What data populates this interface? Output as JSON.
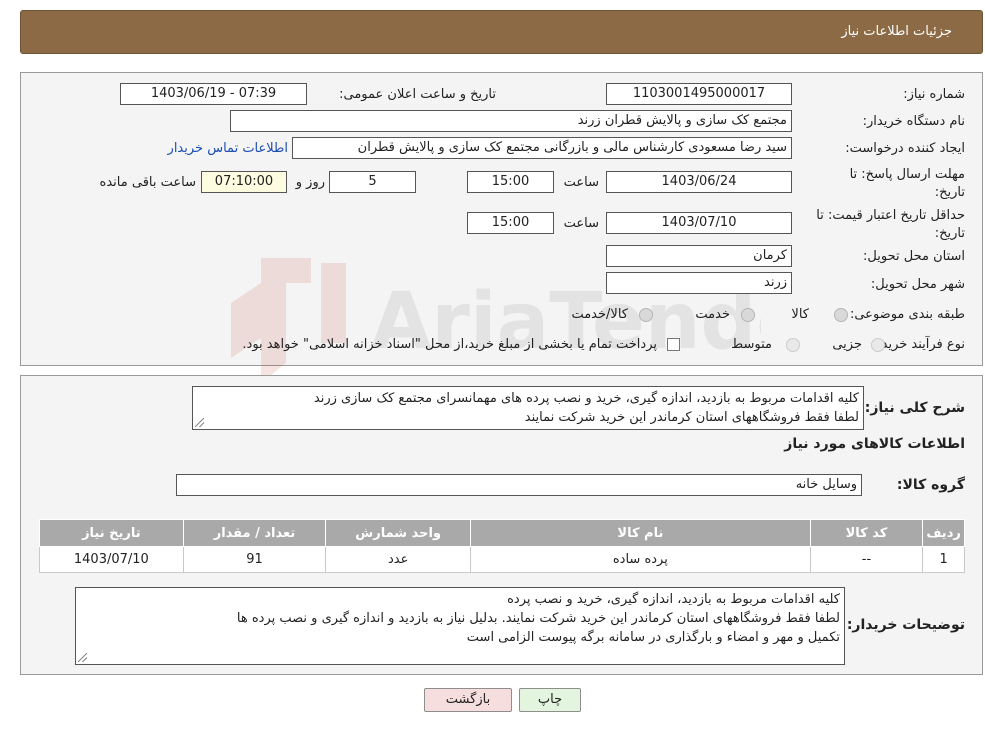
{
  "header": {
    "title": "جزئیات اطلاعات نیاز"
  },
  "form": {
    "need_number_label": "شماره نیاز:",
    "need_number": "1103001495000017",
    "announce_label": "تاریخ و ساعت اعلان عمومی:",
    "announce_value": "1403/06/19 - 07:39",
    "buyer_org_label": "نام دستگاه خریدار:",
    "buyer_org": "مجتمع کک سازی و پالایش قطران زرند",
    "creator_label": "ایجاد کننده درخواست:",
    "creator": "سید رضا مسعودی کارشناس مالی و بازرگانی مجتمع کک سازی و پالایش قطران",
    "contact_link": "اطلاعات تماس خریدار",
    "deadline_label_1": "مهلت ارسال پاسخ: تا",
    "deadline_label_2": "تاریخ:",
    "deadline_date": "1403/06/24",
    "time_label": "ساعت",
    "deadline_time": "15:00",
    "days_value": "5",
    "days_label": "روز و",
    "remaining_time": "07:10:00",
    "remaining_label": "ساعت باقی مانده",
    "validity_label_1": "حداقل تاریخ اعتبار قیمت: تا",
    "validity_label_2": "تاریخ:",
    "validity_date": "1403/07/10",
    "validity_time": "15:00",
    "province_label": "استان محل تحویل:",
    "province": "کرمان",
    "city_label": "شهر محل تحویل:",
    "city": "زرند",
    "category_label": "طبقه بندی موضوعی:",
    "category_options": [
      "کالا",
      "خدمت",
      "کالا/خدمت"
    ],
    "process_label": "نوع فرآیند خرید :",
    "process_options": [
      "جزیی",
      "متوسط"
    ],
    "payment_note": "پرداخت تمام یا بخشی از مبلغ خرید،از محل \"اسناد خزانه اسلامی\" خواهد بود."
  },
  "summary": {
    "description_label": "شرح کلی نیاز:",
    "description_lines": [
      "کلیه اقدامات مربوط به بازدید، اندازه گیری، خرید و نصب پرده های مهمانسرای مجتمع کک سازی زرند",
      "لطفا فقط فروشگاههای استان کرماندر این خرید شرکت نمایند"
    ],
    "goods_info_title": "اطلاعات کالاهای مورد نیاز",
    "goods_group_label": "گروه کالا:",
    "goods_group": "وسایل خانه"
  },
  "table": {
    "headers": [
      "ردیف",
      "کد کالا",
      "نام کالا",
      "واحد شمارش",
      "تعداد / مقدار",
      "تاریخ نیاز"
    ],
    "rows": [
      [
        "1",
        "--",
        "پرده ساده",
        "عدد",
        "91",
        "1403/07/10"
      ]
    ]
  },
  "buyer_notes": {
    "label": "توضیحات خریدار:",
    "lines": [
      "کلیه اقدامات مربوط به بازدید، اندازه گیری، خرید و نصب پرده",
      "لطفا فقط فروشگاههای استان کرماندر این خرید شرکت نمایند. بدلیل نیاز به بازدید و اندازه گیری و نصب پرده ها",
      "تکمیل و مهر و امضاء و بارگذاری در سامانه برگه پیوست الزامی است"
    ]
  },
  "buttons": {
    "print": "چاپ",
    "back": "بازگشت"
  },
  "colors": {
    "header_bg": "#8B6A45",
    "table_header": "#a9a9a9",
    "back_button_bg": "#f7dede",
    "print_button_bg": "#e3f5df"
  }
}
